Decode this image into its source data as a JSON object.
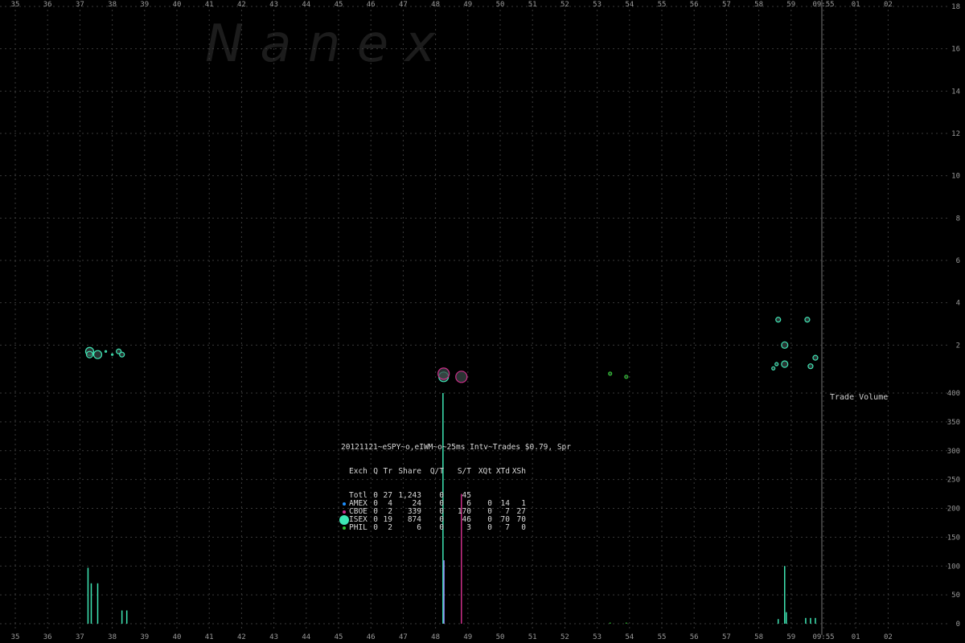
{
  "watermark": "N   a   n   e   x",
  "chart_data": [
    {
      "type": "scatter",
      "title": "",
      "x_ticks": [
        "35",
        "36",
        "37",
        "38",
        "39",
        "40",
        "41",
        "42",
        "43",
        "44",
        "45",
        "46",
        "47",
        "48",
        "49",
        "50",
        "51",
        "52",
        "53",
        "54",
        "55",
        "56",
        "57",
        "58",
        "59",
        "09:55",
        "01",
        "02"
      ],
      "y_ticks": [
        "2",
        "4",
        "6",
        "8",
        "10",
        "12",
        "14",
        "16",
        "18"
      ],
      "ylim": [
        0,
        18
      ],
      "grid": true,
      "series": [
        {
          "color": "#3ee6b4",
          "points": [
            {
              "x": 37.3,
              "y": 1.7,
              "size": 5
            },
            {
              "x": 37.3,
              "y": 1.55,
              "size": 4
            },
            {
              "x": 37.55,
              "y": 1.55,
              "size": 5
            },
            {
              "x": 37.8,
              "y": 1.7,
              "size": 1
            },
            {
              "x": 38.0,
              "y": 1.55,
              "size": 1
            },
            {
              "x": 38.2,
              "y": 1.7,
              "size": 3
            },
            {
              "x": 38.3,
              "y": 1.55,
              "size": 3
            }
          ]
        },
        {
          "color": "#3ee6b4",
          "points": [
            {
              "x": 48.25,
              "y": 0.5,
              "size": 6
            },
            {
              "x": 58.6,
              "y": 3.2,
              "size": 3
            },
            {
              "x": 59.5,
              "y": 3.2,
              "size": 3
            },
            {
              "x": 58.8,
              "y": 2.0,
              "size": 4
            },
            {
              "x": 58.8,
              "y": 1.1,
              "size": 4
            },
            {
              "x": 58.45,
              "y": 0.9,
              "size": 2
            },
            {
              "x": 58.55,
              "y": 1.1,
              "size": 2
            },
            {
              "x": 59.6,
              "y": 1.0,
              "size": 3
            },
            {
              "x": 59.75,
              "y": 1.4,
              "size": 3
            }
          ]
        },
        {
          "color": "#cc2e8a",
          "points": [
            {
              "x": 48.25,
              "y": 0.65,
              "size": 7
            },
            {
              "x": 48.8,
              "y": 0.5,
              "size": 7
            }
          ]
        },
        {
          "color": "#2fbf2f",
          "points": [
            {
              "x": 53.4,
              "y": 0.65,
              "size": 2
            },
            {
              "x": 53.9,
              "y": 0.5,
              "size": 2
            }
          ]
        }
      ],
      "vline_x": 59.95
    },
    {
      "type": "bar",
      "title": "Trade Volume",
      "y_ticks": [
        "0",
        "50",
        "100",
        "150",
        "200",
        "250",
        "300",
        "350",
        "400"
      ],
      "ylim": [
        0,
        400
      ],
      "bars": [
        {
          "x": 37.25,
          "value": 97,
          "color": "#3ee6b4"
        },
        {
          "x": 37.35,
          "value": 70,
          "color": "#3ee6b4"
        },
        {
          "x": 37.55,
          "value": 70,
          "color": "#3ee6b4"
        },
        {
          "x": 38.3,
          "value": 23,
          "color": "#3ee6b4"
        },
        {
          "x": 38.45,
          "value": 23,
          "color": "#3ee6b4"
        },
        {
          "x": 48.23,
          "value": 400,
          "color": "#3ee6b4"
        },
        {
          "x": 48.26,
          "value": 110,
          "color": "#9b8fff"
        },
        {
          "x": 48.8,
          "value": 225,
          "color": "#cc2e8a"
        },
        {
          "x": 53.4,
          "value": 2,
          "color": "#2fbf2f"
        },
        {
          "x": 53.9,
          "value": 2,
          "color": "#2fbf2f"
        },
        {
          "x": 58.6,
          "value": 8,
          "color": "#3ee6b4"
        },
        {
          "x": 58.8,
          "value": 100,
          "color": "#3ee6b4"
        },
        {
          "x": 58.85,
          "value": 20,
          "color": "#3ee6b4"
        },
        {
          "x": 59.45,
          "value": 10,
          "color": "#3ee6b4"
        },
        {
          "x": 59.6,
          "value": 10,
          "color": "#3ee6b4"
        },
        {
          "x": 59.75,
          "value": 10,
          "color": "#3ee6b4"
        }
      ]
    }
  ],
  "stats": {
    "header": "20121121~eSPY~o,eIWM~o~25ms Intv~Trades $0.79, Spr",
    "columns": [
      "Exch",
      "Q",
      "Tr",
      "Share",
      "Q/T",
      "S/T",
      "XQt",
      "XTd",
      "XSh"
    ],
    "rows": [
      {
        "exch": "Totl",
        "q": "0",
        "tr": "27",
        "share": "1,243",
        "qt": "0",
        "st": "45",
        "xqt": "",
        "xtd": "",
        "xsh": "",
        "dot": "",
        "big": false
      },
      {
        "exch": "AMEX",
        "q": "0",
        "tr": "4",
        "share": "24",
        "qt": "0",
        "st": "6",
        "xqt": "0",
        "xtd": "14",
        "xsh": "1",
        "dot": "#1e90ff",
        "big": false
      },
      {
        "exch": "CBOE",
        "q": "0",
        "tr": "2",
        "share": "339",
        "qt": "0",
        "st": "170",
        "xqt": "0",
        "xtd": "7",
        "xsh": "27",
        "dot": "#cc2e8a",
        "big": false
      },
      {
        "exch": "ISEX",
        "q": "0",
        "tr": "19",
        "share": "874",
        "qt": "0",
        "st": "46",
        "xqt": "0",
        "xtd": "70",
        "xsh": "70",
        "dot": "#3ee6b4",
        "big": true
      },
      {
        "exch": "PHIL",
        "q": "0",
        "tr": "2",
        "share": "6",
        "qt": "0",
        "st": "3",
        "xqt": "0",
        "xtd": "7",
        "xsh": "0",
        "dot": "#2fbf2f",
        "big": false
      }
    ]
  }
}
